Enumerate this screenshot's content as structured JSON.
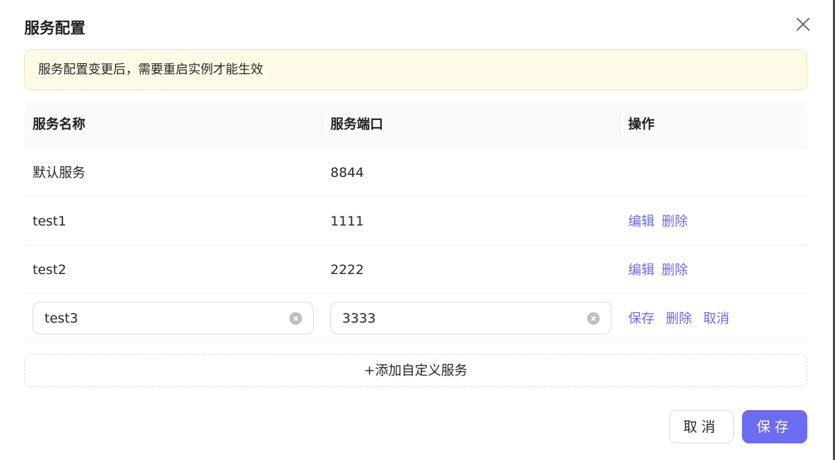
{
  "dialog": {
    "title": "服务配置",
    "alert": "服务配置变更后，需要重启实例才能生效"
  },
  "table": {
    "headers": [
      "服务名称",
      "服务端口",
      "操作"
    ],
    "rows": [
      {
        "name": "默认服务",
        "port": "8844"
      },
      {
        "name": "test1",
        "port": "1111",
        "edit": "编辑",
        "delete": "删除"
      },
      {
        "name": "test2",
        "port": "2222",
        "edit": "编辑",
        "delete": "删除"
      }
    ],
    "editing_row": {
      "name_value": "test3",
      "port_value": "3333",
      "save": "保存",
      "delete": "删除",
      "cancel": "取消"
    }
  },
  "add_button": "+添加自定义服务",
  "footer": {
    "cancel": "取消",
    "save": "保存"
  },
  "colors": {
    "primary": "#6c6cf2",
    "link": "#6b6be6",
    "alert_bg": "#fffbe6",
    "alert_border": "#f3e3a0"
  }
}
